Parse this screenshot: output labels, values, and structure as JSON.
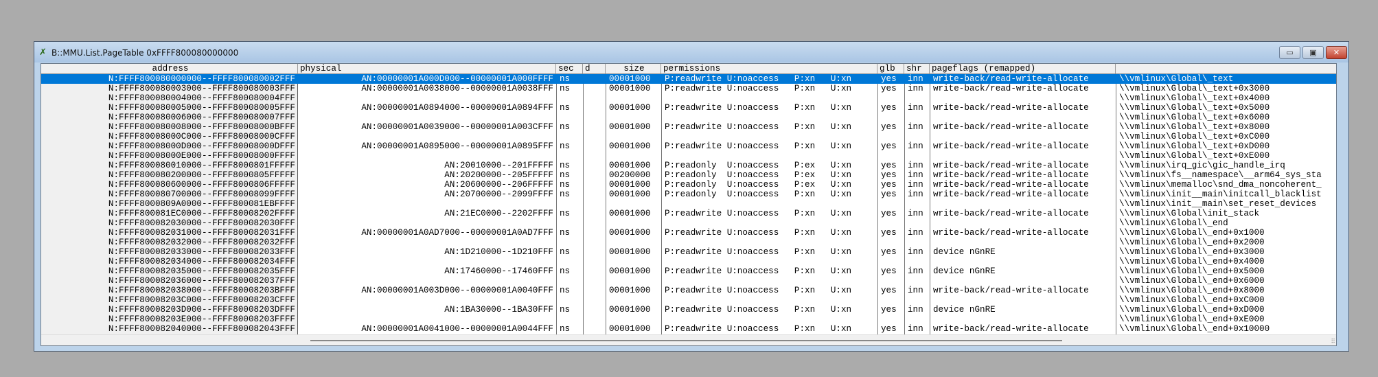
{
  "window": {
    "title": "B::MMU.List.PageTable 0xFFFF800080000000",
    "minimize": "▭",
    "maximize": "▣",
    "close": "✕"
  },
  "colors": {
    "selection": "#0078d7",
    "frame": "#bcd3ea"
  },
  "columns": {
    "address": "address",
    "physical": "physical",
    "sec": "sec",
    "d": "d",
    "size": "size",
    "permissions": "permissions",
    "glb": "glb",
    "shr": "shr",
    "pageflags": "pageflags (remapped)",
    "symbol": ""
  },
  "rows": [
    {
      "address": "N:FFFF800080000000--FFFF800080002FFF",
      "physical": "AN:00000001A000D000--00000001A000FFFF",
      "sec": "ns",
      "d": "",
      "size": "00001000",
      "perm": "P:readwrite U:noaccess   P:xn   U:xn",
      "glb": "yes",
      "shr": "inn",
      "flags": "write-back/read-write-allocate",
      "symbol": "\\\\vmlinux\\Global\\_text",
      "selected": true
    },
    {
      "address": "N:FFFF800080003000--FFFF800080003FFF",
      "physical": "AN:00000001A0038000--00000001A0038FFF",
      "sec": "ns",
      "d": "",
      "size": "00001000",
      "perm": "P:readwrite U:noaccess   P:xn   U:xn",
      "glb": "yes",
      "shr": "inn",
      "flags": "write-back/read-write-allocate",
      "symbol": "\\\\vmlinux\\Global\\_text+0x3000"
    },
    {
      "address": "N:FFFF800080004000--FFFF800080004FFF",
      "physical": "",
      "sec": "",
      "d": "",
      "size": "",
      "perm": "",
      "glb": "",
      "shr": "",
      "flags": "",
      "symbol": "\\\\vmlinux\\Global\\_text+0x4000"
    },
    {
      "address": "N:FFFF800080005000--FFFF800080005FFF",
      "physical": "AN:00000001A0894000--00000001A0894FFF",
      "sec": "ns",
      "d": "",
      "size": "00001000",
      "perm": "P:readwrite U:noaccess   P:xn   U:xn",
      "glb": "yes",
      "shr": "inn",
      "flags": "write-back/read-write-allocate",
      "symbol": "\\\\vmlinux\\Global\\_text+0x5000"
    },
    {
      "address": "N:FFFF800080006000--FFFF800080007FFF",
      "physical": "",
      "sec": "",
      "d": "",
      "size": "",
      "perm": "",
      "glb": "",
      "shr": "",
      "flags": "",
      "symbol": "\\\\vmlinux\\Global\\_text+0x6000"
    },
    {
      "address": "N:FFFF800080008000--FFFF80008000BFFF",
      "physical": "AN:00000001A0039000--00000001A003CFFF",
      "sec": "ns",
      "d": "",
      "size": "00001000",
      "perm": "P:readwrite U:noaccess   P:xn   U:xn",
      "glb": "yes",
      "shr": "inn",
      "flags": "write-back/read-write-allocate",
      "symbol": "\\\\vmlinux\\Global\\_text+0x8000"
    },
    {
      "address": "N:FFFF80008000C000--FFFF80008000CFFF",
      "physical": "",
      "sec": "",
      "d": "",
      "size": "",
      "perm": "",
      "glb": "",
      "shr": "",
      "flags": "",
      "symbol": "\\\\vmlinux\\Global\\_text+0xC000"
    },
    {
      "address": "N:FFFF80008000D000--FFFF80008000DFFF",
      "physical": "AN:00000001A0895000--00000001A0895FFF",
      "sec": "ns",
      "d": "",
      "size": "00001000",
      "perm": "P:readwrite U:noaccess   P:xn   U:xn",
      "glb": "yes",
      "shr": "inn",
      "flags": "write-back/read-write-allocate",
      "symbol": "\\\\vmlinux\\Global\\_text+0xD000"
    },
    {
      "address": "N:FFFF80008000E000--FFFF80008000FFFF",
      "physical": "",
      "sec": "",
      "d": "",
      "size": "",
      "perm": "",
      "glb": "",
      "shr": "",
      "flags": "",
      "symbol": "\\\\vmlinux\\Global\\_text+0xE000"
    },
    {
      "address": "N:FFFF800080010000--FFFF8000801FFFFF",
      "physical": "AN:20010000--201FFFFF",
      "sec": "ns",
      "d": "",
      "size": "00001000",
      "perm": "P:readonly  U:noaccess   P:ex   U:xn",
      "glb": "yes",
      "shr": "inn",
      "flags": "write-back/read-write-allocate",
      "symbol": "\\\\vmlinux\\irq_gic\\gic_handle_irq"
    },
    {
      "address": "N:FFFF800080200000--FFFF8000805FFFFF",
      "physical": "AN:20200000--205FFFFF",
      "sec": "ns",
      "d": "",
      "size": "00200000",
      "perm": "P:readonly  U:noaccess   P:ex   U:xn",
      "glb": "yes",
      "shr": "inn",
      "flags": "write-back/read-write-allocate",
      "symbol": "\\\\vmlinux\\fs__namespace\\__arm64_sys_sta"
    },
    {
      "address": "N:FFFF800080600000--FFFF8000806FFFFF",
      "physical": "AN:20600000--206FFFFF",
      "sec": "ns",
      "d": "",
      "size": "00001000",
      "perm": "P:readonly  U:noaccess   P:ex   U:xn",
      "glb": "yes",
      "shr": "inn",
      "flags": "write-back/read-write-allocate",
      "symbol": "\\\\vmlinux\\memalloc\\snd_dma_noncoherent_"
    },
    {
      "address": "N:FFFF800080700000--FFFF80008099FFFF",
      "physical": "AN:20700000--2099FFFF",
      "sec": "ns",
      "d": "",
      "size": "00001000",
      "perm": "P:readonly  U:noaccess   P:xn   U:xn",
      "glb": "yes",
      "shr": "inn",
      "flags": "write-back/read-write-allocate",
      "symbol": "\\\\vmlinux\\init__main\\initcall_blacklist"
    },
    {
      "address": "N:FFFF8000809A0000--FFFF800081EBFFFF",
      "physical": "",
      "sec": "",
      "d": "",
      "size": "",
      "perm": "",
      "glb": "",
      "shr": "",
      "flags": "",
      "symbol": "\\\\vmlinux\\init__main\\set_reset_devices"
    },
    {
      "address": "N:FFFF800081EC0000--FFFF80008202FFFF",
      "physical": "AN:21EC0000--2202FFFF",
      "sec": "ns",
      "d": "",
      "size": "00001000",
      "perm": "P:readwrite U:noaccess   P:xn   U:xn",
      "glb": "yes",
      "shr": "inn",
      "flags": "write-back/read-write-allocate",
      "symbol": "\\\\vmlinux\\Global\\init_stack"
    },
    {
      "address": "N:FFFF800082030000--FFFF800082030FFF",
      "physical": "",
      "sec": "",
      "d": "",
      "size": "",
      "perm": "",
      "glb": "",
      "shr": "",
      "flags": "",
      "symbol": "\\\\vmlinux\\Global\\_end"
    },
    {
      "address": "N:FFFF800082031000--FFFF800082031FFF",
      "physical": "AN:00000001A0AD7000--00000001A0AD7FFF",
      "sec": "ns",
      "d": "",
      "size": "00001000",
      "perm": "P:readwrite U:noaccess   P:xn   U:xn",
      "glb": "yes",
      "shr": "inn",
      "flags": "write-back/read-write-allocate",
      "symbol": "\\\\vmlinux\\Global\\_end+0x1000"
    },
    {
      "address": "N:FFFF800082032000--FFFF800082032FFF",
      "physical": "",
      "sec": "",
      "d": "",
      "size": "",
      "perm": "",
      "glb": "",
      "shr": "",
      "flags": "",
      "symbol": "\\\\vmlinux\\Global\\_end+0x2000"
    },
    {
      "address": "N:FFFF800082033000--FFFF800082033FFF",
      "physical": "AN:1D210000--1D210FFF",
      "sec": "ns",
      "d": "",
      "size": "00001000",
      "perm": "P:readwrite U:noaccess   P:xn   U:xn",
      "glb": "yes",
      "shr": "inn",
      "flags": "device nGnRE",
      "symbol": "\\\\vmlinux\\Global\\_end+0x3000"
    },
    {
      "address": "N:FFFF800082034000--FFFF800082034FFF",
      "physical": "",
      "sec": "",
      "d": "",
      "size": "",
      "perm": "",
      "glb": "",
      "shr": "",
      "flags": "",
      "symbol": "\\\\vmlinux\\Global\\_end+0x4000"
    },
    {
      "address": "N:FFFF800082035000--FFFF800082035FFF",
      "physical": "AN:17460000--17460FFF",
      "sec": "ns",
      "d": "",
      "size": "00001000",
      "perm": "P:readwrite U:noaccess   P:xn   U:xn",
      "glb": "yes",
      "shr": "inn",
      "flags": "device nGnRE",
      "symbol": "\\\\vmlinux\\Global\\_end+0x5000"
    },
    {
      "address": "N:FFFF800082036000--FFFF800082037FFF",
      "physical": "",
      "sec": "",
      "d": "",
      "size": "",
      "perm": "",
      "glb": "",
      "shr": "",
      "flags": "",
      "symbol": "\\\\vmlinux\\Global\\_end+0x6000"
    },
    {
      "address": "N:FFFF800082038000--FFFF80008203BFFF",
      "physical": "AN:00000001A003D000--00000001A0040FFF",
      "sec": "ns",
      "d": "",
      "size": "00001000",
      "perm": "P:readwrite U:noaccess   P:xn   U:xn",
      "glb": "yes",
      "shr": "inn",
      "flags": "write-back/read-write-allocate",
      "symbol": "\\\\vmlinux\\Global\\_end+0x8000"
    },
    {
      "address": "N:FFFF80008203C000--FFFF80008203CFFF",
      "physical": "",
      "sec": "",
      "d": "",
      "size": "",
      "perm": "",
      "glb": "",
      "shr": "",
      "flags": "",
      "symbol": "\\\\vmlinux\\Global\\_end+0xC000"
    },
    {
      "address": "N:FFFF80008203D000--FFFF80008203DFFF",
      "physical": "AN:1BA30000--1BA30FFF",
      "sec": "ns",
      "d": "",
      "size": "00001000",
      "perm": "P:readwrite U:noaccess   P:xn   U:xn",
      "glb": "yes",
      "shr": "inn",
      "flags": "device nGnRE",
      "symbol": "\\\\vmlinux\\Global\\_end+0xD000"
    },
    {
      "address": "N:FFFF80008203E000--FFFF80008203FFFF",
      "physical": "",
      "sec": "",
      "d": "",
      "size": "",
      "perm": "",
      "glb": "",
      "shr": "",
      "flags": "",
      "symbol": "\\\\vmlinux\\Global\\_end+0xE000"
    },
    {
      "address": "N:FFFF800082040000--FFFF800082043FFF",
      "physical": "AN:00000001A0041000--00000001A0044FFF",
      "sec": "ns",
      "d": "",
      "size": "00001000",
      "perm": "P:readwrite U:noaccess   P:xn   U:xn",
      "glb": "yes",
      "shr": "inn",
      "flags": "write-back/read-write-allocate",
      "symbol": "\\\\vmlinux\\Global\\_end+0x10000"
    }
  ]
}
